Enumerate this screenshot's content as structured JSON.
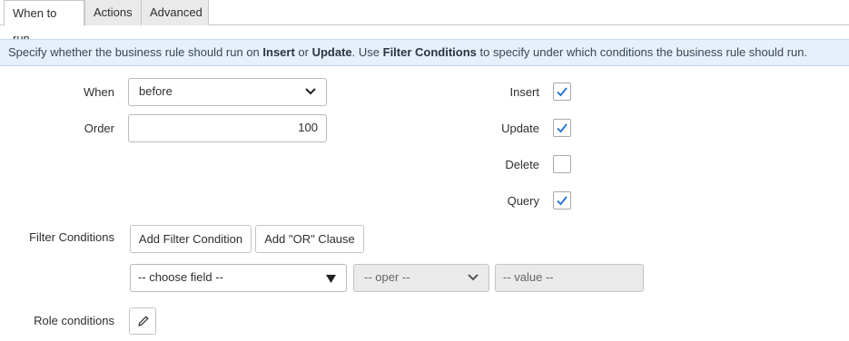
{
  "tabs": [
    {
      "label": "When to run",
      "active": true
    },
    {
      "label": "Actions",
      "active": false
    },
    {
      "label": "Advanced",
      "active": false
    }
  ],
  "info": {
    "p1": "Specify whether the business rule should run on ",
    "b1": "Insert",
    "p2": " or ",
    "b2": "Update",
    "p3": ". Use ",
    "b3": "Filter Conditions",
    "p4": " to specify under which conditions the business rule should run."
  },
  "form": {
    "when_label": "When",
    "when_value": "before",
    "order_label": "Order",
    "order_value": "100",
    "checkboxes": [
      {
        "label": "Insert",
        "checked": true
      },
      {
        "label": "Update",
        "checked": true
      },
      {
        "label": "Delete",
        "checked": false
      },
      {
        "label": "Query",
        "checked": true
      }
    ],
    "filter_label": "Filter Conditions",
    "add_filter_button": "Add Filter Condition",
    "add_or_button": "Add \"OR\" Clause",
    "field_select": "-- choose field --",
    "oper_select": "-- oper --",
    "value_field": "-- value --",
    "role_label": "Role conditions"
  },
  "colors": {
    "check": "#1f6fd1",
    "infobar_bg": "#e5f0fb"
  },
  "icons": {
    "chevron": "chevron-down-icon",
    "triangle": "triangle-down-icon",
    "check": "checkmark-icon",
    "pencil": "pencil-icon"
  }
}
